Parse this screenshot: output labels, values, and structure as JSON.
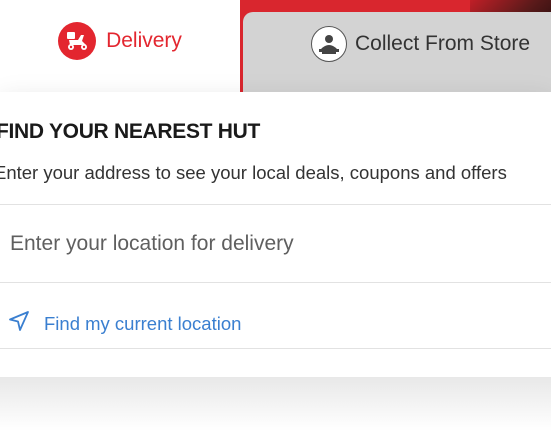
{
  "tabs": {
    "delivery_label": "Delivery",
    "collect_label": "Collect From Store",
    "active": "delivery",
    "delivery_icon": "scooter-icon",
    "collect_icon": "store-person-icon"
  },
  "finder": {
    "heading": "FIND YOUR NEAREST HUT",
    "subheading": "Enter your address to see your local deals, coupons and offers",
    "location_placeholder": "Enter your location for delivery",
    "location_value": "",
    "current_location_label": "Find my current location",
    "current_location_icon": "navigation-arrow-icon"
  },
  "colors": {
    "brand_red": "#e3262f",
    "link_blue": "#3a7fd0",
    "inactive_tab": "#d3d3d3"
  }
}
